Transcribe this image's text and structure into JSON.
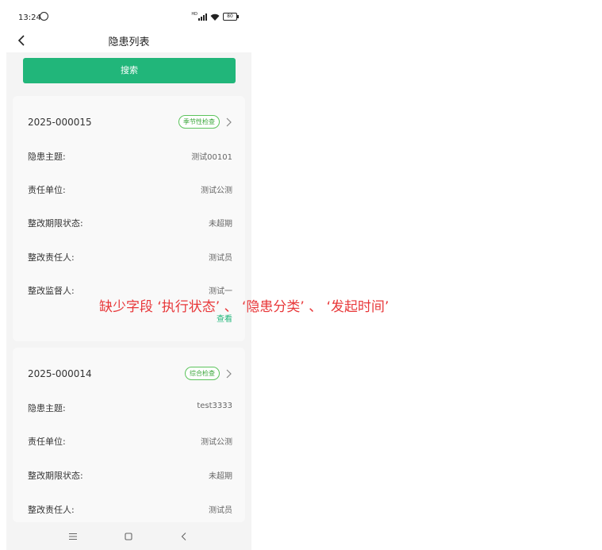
{
  "status_bar": {
    "time": "13:24",
    "hd": "HD",
    "battery": "80"
  },
  "nav": {
    "title": "隐患列表"
  },
  "search": {
    "label": "搜索"
  },
  "cards": [
    {
      "id": "2025-000015",
      "tag": "季节性检查",
      "rows": [
        {
          "label": "隐患主题:",
          "value": "测试00101"
        },
        {
          "label": "责任单位:",
          "value": "测试公测"
        },
        {
          "label": "整改期限状态:",
          "value": "未超期"
        },
        {
          "label": "整改责任人:",
          "value": "测试员"
        },
        {
          "label": "整改监督人:",
          "value": "测试一"
        }
      ],
      "action": "查看"
    },
    {
      "id": "2025-000014",
      "tag": "综合检查",
      "rows": [
        {
          "label": "隐患主题:",
          "value": "test3333"
        },
        {
          "label": "责任单位:",
          "value": "测试公测"
        },
        {
          "label": "整改期限状态:",
          "value": "未超期"
        },
        {
          "label": "整改责任人:",
          "value": "测试员"
        }
      ]
    }
  ],
  "annotation": "缺少字段 ‘执行状态’ 、 ‘隐患分类’ 、 ‘发起时间’",
  "colors": {
    "accent": "#21b67a",
    "tag": "#3aa63a",
    "annotation": "#e8383a"
  }
}
